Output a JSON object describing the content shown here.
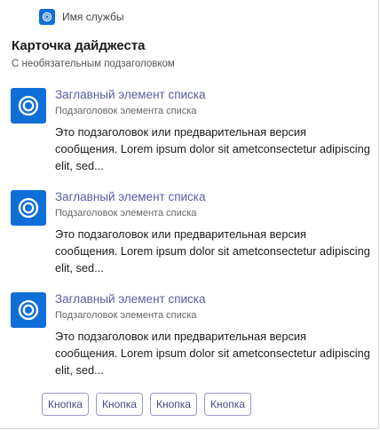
{
  "service": {
    "name": "Имя службы",
    "logo_icon": "service-logo-icon"
  },
  "card": {
    "title": "Карточка дайджеста",
    "subtitle": "С необязательным подзаголовком"
  },
  "items": [
    {
      "title": "Заглавный элемент списка",
      "subtitle": "Подзаголовок элемента списка",
      "text": "Это подзаголовок или предварительная версия сообщения. Lorem ipsum dolor sit ametconsectetur adipiscing elit, sed..."
    },
    {
      "title": "Заглавный элемент списка",
      "subtitle": "Подзаголовок элемента списка",
      "text": "Это подзаголовок или предварительная версия сообщения. Lorem ipsum dolor sit ametconsectetur adipiscing elit, sed..."
    },
    {
      "title": "Заглавный элемент списка",
      "subtitle": "Подзаголовок элемента списка",
      "text": "Это подзаголовок или предварительная версия сообщения. Lorem ipsum dolor sit ametconsectetur adipiscing elit, sed..."
    }
  ],
  "actions": [
    {
      "label": "Кнопка"
    },
    {
      "label": "Кнопка"
    },
    {
      "label": "Кнопка"
    },
    {
      "label": "Кнопка"
    }
  ],
  "colors": {
    "accent": "#0f6fd8",
    "item_title": "#5b5ba8",
    "button_border": "#9a9ac6"
  }
}
